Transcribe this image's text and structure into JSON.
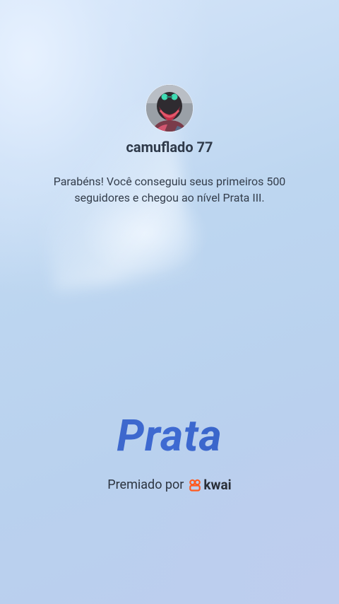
{
  "profile": {
    "username": "camuflado 77"
  },
  "message": "Parabéns! Você conseguiu seus primeiros 500 seguidores e chegou ao nível Prata III.",
  "level": {
    "name": "Prata"
  },
  "award": {
    "prefix": "Premiado por",
    "brand": "kwai",
    "brand_icon": "kwai-logo-icon",
    "brand_color": "#ff5a1f"
  },
  "colors": {
    "level_text": "#3a63c0",
    "text_primary": "#2f3a4a"
  }
}
